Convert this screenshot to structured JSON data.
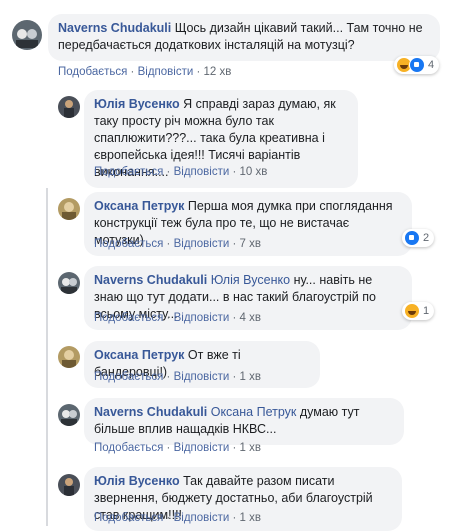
{
  "comments": [
    {
      "author": "Naverns Chudakuli",
      "text": "Щось дизайн цікавий такий... Там точно не передбачається додаткових інсталяцій на мотузці?",
      "like_label": "Подобається",
      "reply_label": "Відповісти",
      "time": "12 хв",
      "reaction_count": "4",
      "reaction_icons": [
        "haha-icon",
        "like-icon"
      ]
    },
    {
      "author": "Юлія Вусенко",
      "text": "Я справді зараз думаю, як таку просту річ можна було так спаплюжити???... така була креативна і європейська ідея!!! Тисячі варіантів виконання....",
      "like_label": "Подобається",
      "reply_label": "Відповісти",
      "time": "10 хв"
    },
    {
      "author": "Оксана Петрук",
      "text": "Перша моя думка при споглядання конструкції теж була про те, що не вистачає мотузки)",
      "like_label": "Подобається",
      "reply_label": "Відповісти",
      "time": "7 хв",
      "reaction_count": "2",
      "reaction_icons": [
        "like-icon"
      ]
    },
    {
      "author": "Naverns Chudakuli",
      "mention": "Юлія Вусенко",
      "text": "ну... навіть не знаю що тут додати... в нас такий благоустрій по всьому місту...",
      "like_label": "Подобається",
      "reply_label": "Відповісти",
      "time": "4 хв",
      "reaction_count": "1",
      "reaction_icons": [
        "haha-icon"
      ]
    },
    {
      "author": "Оксана Петрук",
      "text": "От вже ті бандеровці!)",
      "like_label": "Подобається",
      "reply_label": "Відповісти",
      "time": "1 хв"
    },
    {
      "author": "Naverns Chudakuli",
      "mention": "Оксана Петрук",
      "text": "думаю тут більше вплив нащадків НКВС...",
      "like_label": "Подобається",
      "reply_label": "Відповісти",
      "time": "1 хв"
    },
    {
      "author": "Юлія Вусенко",
      "text": "Так давайте разом писати звернення, бюджету достатньо, аби благоустрій став кращим!!!!",
      "like_label": "Подобається",
      "reply_label": "Відповісти",
      "time": "1 хв"
    }
  ],
  "separator": "·",
  "colors": {
    "name": "#385898",
    "bubble": "#f2f3f5",
    "meta": "#606770",
    "like": "#1877f2",
    "haha": "#f7b125"
  }
}
